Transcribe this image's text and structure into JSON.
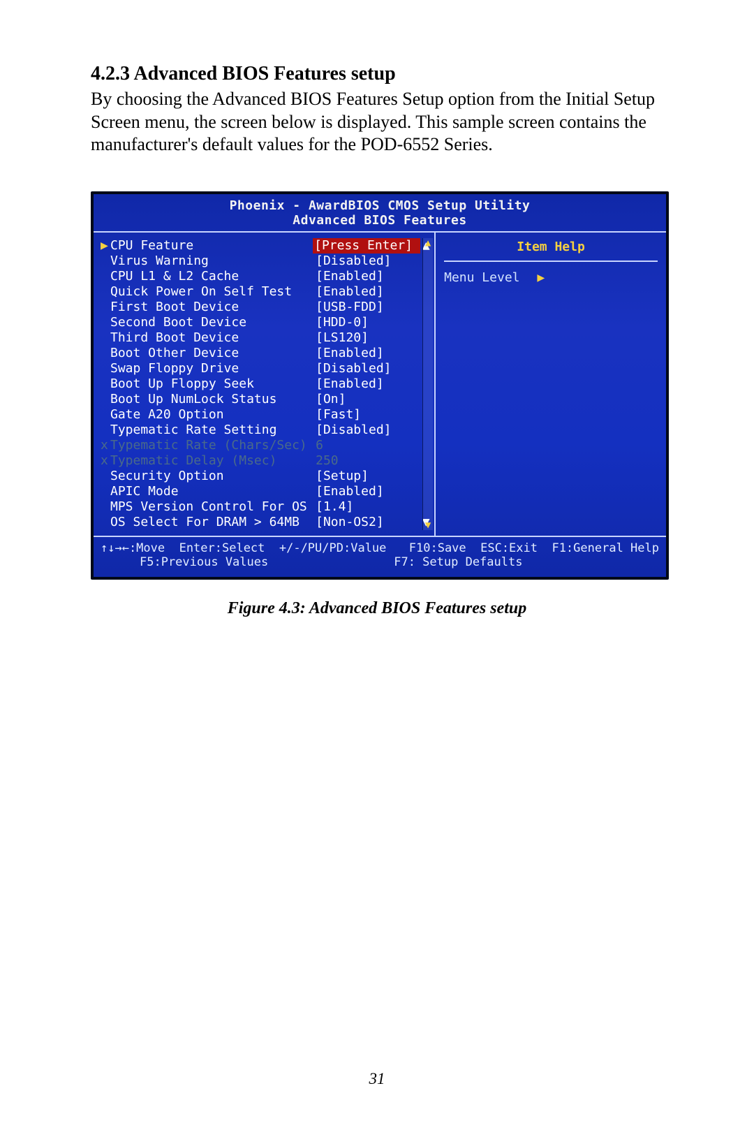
{
  "doc": {
    "section_heading": "4.2.3 Advanced BIOS Features setup",
    "body_text": "By choosing the Advanced BIOS Features Setup option from the Initial Setup Screen menu, the screen below is displayed. This sample screen contains the manufacturer's default values for the POD-6552 Series.",
    "figure_caption": "Figure 4.3: Advanced BIOS Features setup",
    "page_number": "31"
  },
  "bios": {
    "header_line1": "Phoenix - AwardBIOS CMOS Setup Utility",
    "header_line2": "Advanced BIOS Features",
    "help": {
      "title": "Item Help",
      "menu_level_label": "Menu Level"
    },
    "options": [
      {
        "marker": "tri",
        "label": "CPU Feature",
        "value": "[Press Enter]",
        "selected": true,
        "disabled": false,
        "arrow": "up"
      },
      {
        "marker": "",
        "label": "Virus Warning",
        "value": "[Disabled]",
        "selected": false,
        "disabled": false,
        "arrow": ""
      },
      {
        "marker": "",
        "label": "CPU L1 & L2 Cache",
        "value": "[Enabled]",
        "selected": false,
        "disabled": false,
        "arrow": ""
      },
      {
        "marker": "",
        "label": "Quick Power On Self Test",
        "value": "[Enabled]",
        "selected": false,
        "disabled": false,
        "arrow": ""
      },
      {
        "marker": "",
        "label": "First Boot Device",
        "value": "[USB-FDD]",
        "selected": false,
        "disabled": false,
        "arrow": ""
      },
      {
        "marker": "",
        "label": "Second Boot Device",
        "value": "[HDD-0]",
        "selected": false,
        "disabled": false,
        "arrow": ""
      },
      {
        "marker": "",
        "label": "Third Boot Device",
        "value": "[LS120]",
        "selected": false,
        "disabled": false,
        "arrow": ""
      },
      {
        "marker": "",
        "label": "Boot Other Device",
        "value": "[Enabled]",
        "selected": false,
        "disabled": false,
        "arrow": ""
      },
      {
        "marker": "",
        "label": "Swap Floppy Drive",
        "value": "[Disabled]",
        "selected": false,
        "disabled": false,
        "arrow": ""
      },
      {
        "marker": "",
        "label": "Boot Up Floppy Seek",
        "value": "[Enabled]",
        "selected": false,
        "disabled": false,
        "arrow": ""
      },
      {
        "marker": "",
        "label": "Boot Up NumLock Status",
        "value": "[On]",
        "selected": false,
        "disabled": false,
        "arrow": ""
      },
      {
        "marker": "",
        "label": "Gate A20 Option",
        "value": "[Fast]",
        "selected": false,
        "disabled": false,
        "arrow": ""
      },
      {
        "marker": "",
        "label": "Typematic Rate Setting",
        "value": "[Disabled]",
        "selected": false,
        "disabled": false,
        "arrow": ""
      },
      {
        "marker": "x",
        "label": "Typematic Rate (Chars/Sec)",
        "value": "6",
        "selected": false,
        "disabled": true,
        "arrow": ""
      },
      {
        "marker": "x",
        "label": "Typematic Delay (Msec)",
        "value": "250",
        "selected": false,
        "disabled": true,
        "arrow": ""
      },
      {
        "marker": "",
        "label": "Security Option",
        "value": "[Setup]",
        "selected": false,
        "disabled": false,
        "arrow": ""
      },
      {
        "marker": "",
        "label": "APIC Mode",
        "value": "[Enabled]",
        "selected": false,
        "disabled": false,
        "arrow": ""
      },
      {
        "marker": "",
        "label": "MPS Version Control For OS",
        "value": "[1.4]",
        "selected": false,
        "disabled": false,
        "arrow": ""
      },
      {
        "marker": "",
        "label": "OS Select For DRAM > 64MB",
        "value": "[Non-OS2]",
        "selected": false,
        "disabled": false,
        "arrow": "down"
      }
    ],
    "footer": {
      "row1_left": "↑↓→←:Move  Enter:Select  +/-/PU/PD:Value",
      "row1_right": "F10:Save  ESC:Exit  F1:General Help",
      "row2_left": "F5:Previous Values",
      "row2_right": "F7: Setup Defaults"
    }
  }
}
